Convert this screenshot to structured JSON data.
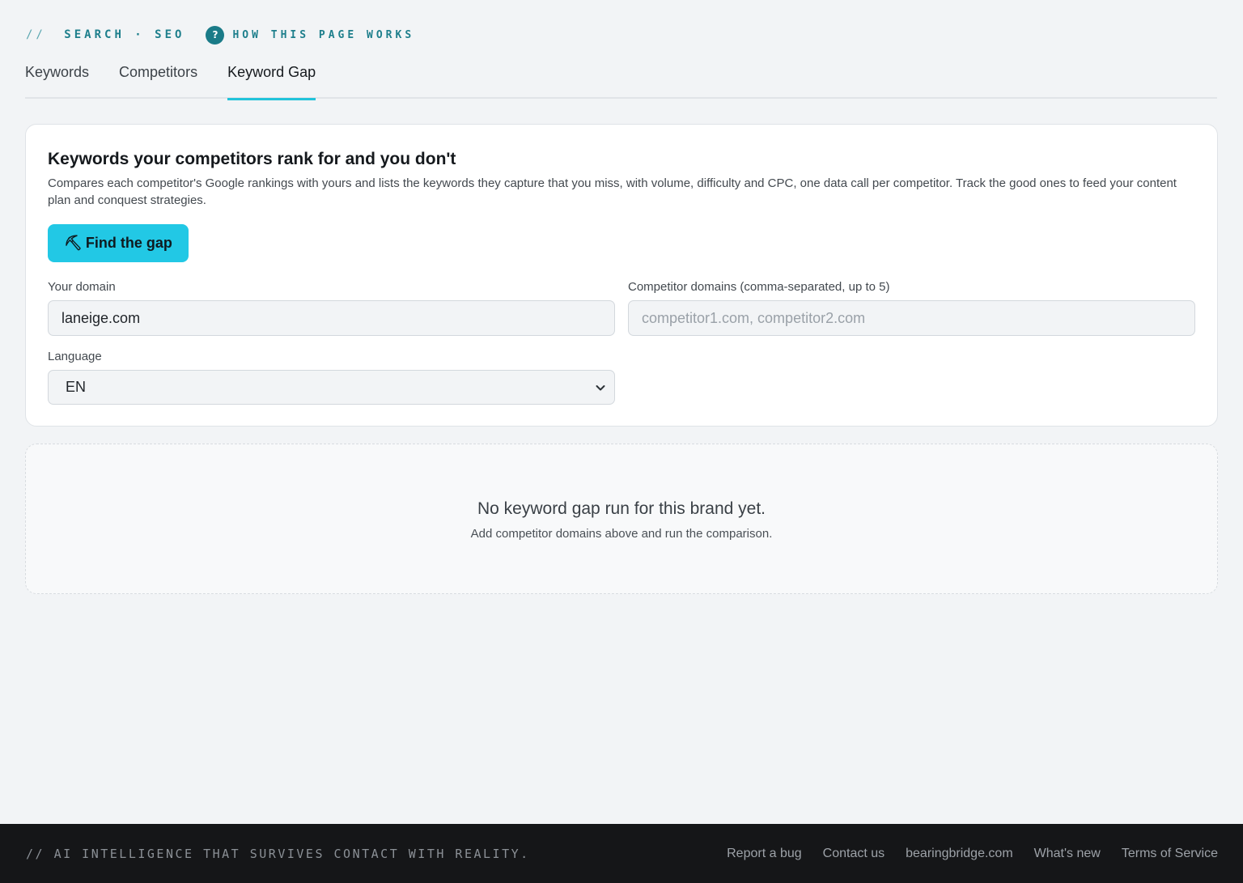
{
  "header": {
    "breadcrumb_slash": "//",
    "breadcrumb": "SEARCH · SEO",
    "help_icon_glyph": "?",
    "how_link": "HOW THIS PAGE WORKS"
  },
  "tabs": [
    {
      "label": "Keywords",
      "active": false
    },
    {
      "label": "Competitors",
      "active": false
    },
    {
      "label": "Keyword Gap",
      "active": true
    }
  ],
  "card": {
    "title": "Keywords your competitors rank for and you don't",
    "description": "Compares each competitor's Google rankings with yours and lists the keywords they capture that you miss, with volume, difficulty and CPC, one data call per competitor. Track the good ones to feed your content plan and conquest strategies.",
    "button_icon": "⛏",
    "button_label": "Find the gap",
    "domain_label": "Your domain",
    "domain_value": "laneige.com",
    "competitors_label": "Competitor domains (comma-separated, up to 5)",
    "competitors_placeholder": "competitor1.com, competitor2.com",
    "language_label": "Language",
    "language_value": "EN"
  },
  "empty_state": {
    "title": "No keyword gap run for this brand yet.",
    "subtitle": "Add competitor domains above and run the comparison."
  },
  "footer": {
    "tagline": "// AI INTELLIGENCE THAT SURVIVES CONTACT WITH REALITY.",
    "links": [
      "Report a bug",
      "Contact us",
      "bearingbridge.com",
      "What's new",
      "Terms of Service"
    ]
  },
  "colors": {
    "accent": "#22c8e5",
    "brand_teal": "#1e7f8c",
    "footer_bg": "#151618"
  },
  "icons": {
    "help": "question-circle-icon",
    "button": "pickaxe-icon",
    "select": "chevron-down-icon"
  }
}
